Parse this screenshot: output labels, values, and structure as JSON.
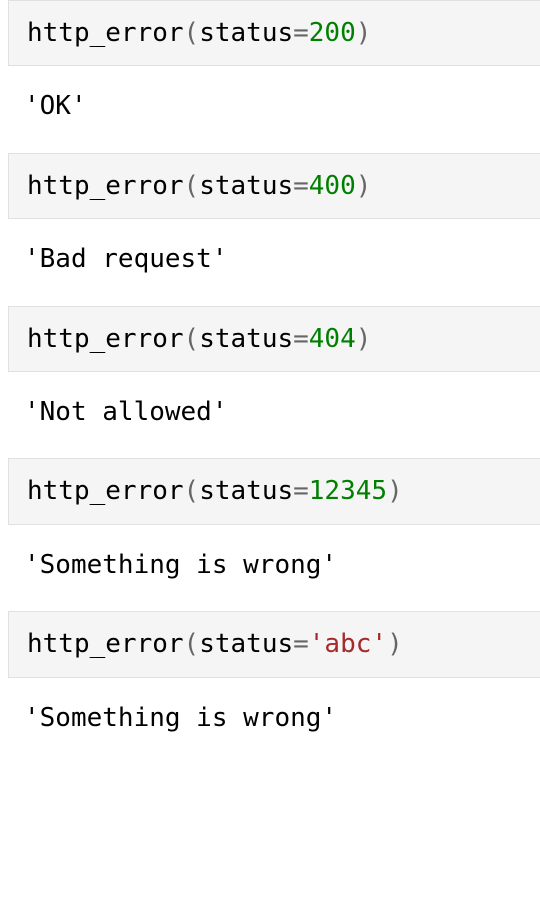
{
  "cells": [
    {
      "fn": "http_error",
      "arg": "status",
      "eq": "=",
      "val": "200",
      "val_class": "num",
      "output": "'OK'"
    },
    {
      "fn": "http_error",
      "arg": "status",
      "eq": "=",
      "val": "400",
      "val_class": "num",
      "output": "'Bad request'"
    },
    {
      "fn": "http_error",
      "arg": "status",
      "eq": "=",
      "val": "404",
      "val_class": "num",
      "output": "'Not allowed'"
    },
    {
      "fn": "http_error",
      "arg": "status",
      "eq": "=",
      "val": "12345",
      "val_class": "num",
      "output": "'Something is wrong'"
    },
    {
      "fn": "http_error",
      "arg": "status",
      "eq": "=",
      "val": "'abc'",
      "val_class": "str",
      "output": "'Something is wrong'"
    }
  ],
  "paren_open": "(",
  "paren_close": ")"
}
